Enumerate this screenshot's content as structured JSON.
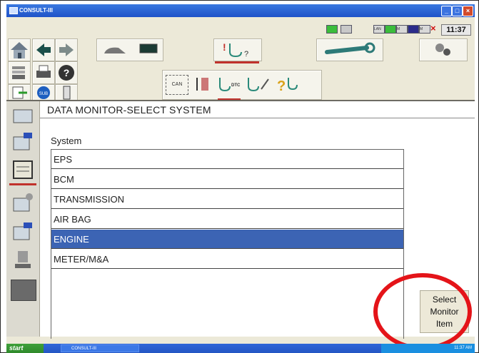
{
  "window": {
    "title": "CONSULT-III",
    "clock": "11:37"
  },
  "status_indicators": {
    "lan": "LAN",
    "m1": "M",
    "m2": "M"
  },
  "toolbar": {
    "can_label": "CAN",
    "dtc_label": "DTC",
    "sub_label": "SUB",
    "help_glyph": "?"
  },
  "page": {
    "title": "DATA MONITOR-SELECT SYSTEM",
    "system_label": "System",
    "systems": [
      "EPS",
      "BCM",
      "TRANSMISSION",
      "AIR BAG",
      "ENGINE",
      "METER/M&A"
    ],
    "selected": "ENGINE"
  },
  "select_button": {
    "line1": "Select",
    "line2": "Monitor",
    "line3": "Item"
  },
  "taskbar": {
    "start": "start",
    "item": "CONSULT-III",
    "tray_time": "11:37 AM"
  },
  "colors": {
    "highlight": "#3c64b4",
    "annotation_circle": "#e41419",
    "accent_bar": "#c0312b"
  },
  "icons": {
    "home": "home-icon",
    "back": "arrow-left-icon",
    "forward": "arrow-right-icon",
    "car_battery": "car-battery-icon",
    "diagnosis": "stethoscope-icon",
    "wrench": "wrench-icon",
    "settings": "gears-icon",
    "printer": "printer-icon",
    "camera": "camera-icon",
    "help": "help-icon"
  }
}
